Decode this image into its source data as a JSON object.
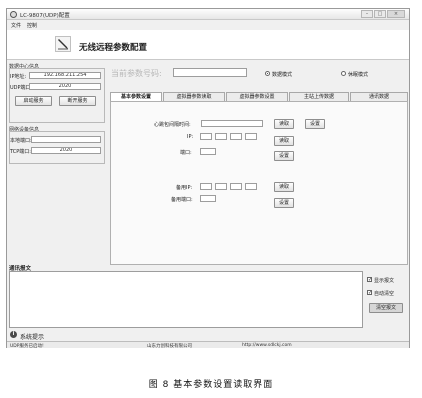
{
  "window": {
    "title": "LC-9807(UDP)配置",
    "buttons": {
      "minimize": "–",
      "maximize": "□",
      "close": "×"
    }
  },
  "menu": {
    "items": [
      "文件",
      "控制"
    ]
  },
  "header": {
    "title": "无线远程参数配置"
  },
  "data_center": {
    "group_label": "数据中心信息",
    "ip_label": "IP地址:",
    "ip_value": "192.168.211.254",
    "port_label": "UDP端口:",
    "port_value": "2020",
    "start_button": "启动服务",
    "stop_button": "断开服务"
  },
  "network_device": {
    "group_label": "网络设备信息",
    "local_port_label": "本地端口:",
    "local_port_value": "",
    "tcp_port_label": "TCP端口:",
    "tcp_port_value": "2020"
  },
  "device": {
    "id_label": "当前参数号码:",
    "id_value": ""
  },
  "mode": {
    "option1": "数据模式",
    "option2": "休眠模式",
    "selected": "数据模式"
  },
  "tabs": [
    "基本参数设置",
    "虚拟器参数读取",
    "虚拟器参数设置",
    "主站上传数据",
    "通讯数据"
  ],
  "basic": {
    "heartbeat_label": "心跳包间隔时间:",
    "heartbeat_value": "",
    "read1_button": "读取",
    "set1_button": "设置",
    "ip_label": "IP:",
    "read2_button": "读取",
    "port_label": "端口:",
    "set2_button": "设置",
    "backup_ip_label": "备用IP:",
    "read3_button": "读取",
    "backup_port_label": "备用端口:",
    "set3_button": "设置"
  },
  "comm": {
    "label": "通讯报文",
    "show_checkbox": "显示报文",
    "auto_clear_checkbox": "自动清空",
    "clear_button": "清空报文"
  },
  "system": {
    "label": "系统提示"
  },
  "status_bar": {
    "left": "UDP服务已启动!",
    "center": "山东力创科技有限公司",
    "right": "http://www.sdlckj.com"
  },
  "caption": "图 8   基本参数设置读取界面"
}
